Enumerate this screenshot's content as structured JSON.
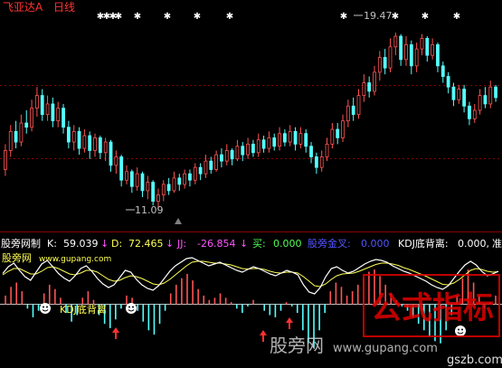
{
  "stock_title": "飞亚达A",
  "period": "日线",
  "colors": {
    "background": "#000000",
    "up": "#ff5454",
    "down": "#54ffff",
    "k_line": "#ffffff",
    "d_line": "#ffff54",
    "grid": "#8b0000",
    "title_red": "#ff3333",
    "magenta": "#ff54ff",
    "green": "#54ff54",
    "blue": "#5454ff",
    "yellow": "#ffff54"
  },
  "indicator": {
    "name": "股旁网制",
    "k_label": "K:",
    "k_value": "59.039",
    "k_arrow": "↓",
    "d_label": "D:",
    "d_value": "72.465",
    "d_arrow": "↓",
    "jj_label": "JJ:",
    "jj_value": "-26.854",
    "jj_arrow": "↓",
    "buy_label": "买:",
    "buy_value": "0.000",
    "gold_label": "股旁金叉:",
    "gold_value": "0.000",
    "kdj_label": "KDJ底背离:",
    "kdj_value": "0.000,",
    "trail": "准"
  },
  "site_name": "股旁网",
  "site_url": "www.gupang.com",
  "kdj_tag": "KDJ底背离",
  "watermark": {
    "cn": "股旁网",
    "url": "www.gupang.com",
    "seal": "公式指标",
    "seal_url": "gszb.com"
  },
  "chart_data": {
    "type": "candlestick",
    "price_high_label": "19.47",
    "price_low_label": "11.09",
    "ylim": [
      10.5,
      20.5
    ],
    "candles": [
      [
        13.0,
        13.9,
        12.7,
        14.2
      ],
      [
        13.9,
        14.8,
        13.6,
        15.1
      ],
      [
        14.8,
        14.3,
        14.0,
        15.3
      ],
      [
        14.3,
        15.2,
        14.1,
        15.6
      ],
      [
        15.2,
        15.0,
        14.7,
        15.8
      ],
      [
        15.0,
        15.9,
        14.8,
        16.3
      ],
      [
        15.9,
        16.5,
        15.5,
        16.9
      ],
      [
        16.5,
        15.6,
        15.3,
        16.8
      ],
      [
        15.6,
        16.1,
        15.3,
        16.5
      ],
      [
        16.1,
        15.3,
        15.0,
        16.4
      ],
      [
        15.3,
        15.9,
        15.0,
        16.2
      ],
      [
        15.9,
        15.0,
        14.7,
        16.1
      ],
      [
        15.0,
        14.3,
        14.0,
        15.3
      ],
      [
        14.3,
        14.8,
        13.9,
        15.1
      ],
      [
        14.8,
        14.0,
        13.7,
        15.0
      ],
      [
        14.0,
        14.6,
        13.8,
        14.9
      ],
      [
        14.6,
        13.9,
        13.5,
        14.8
      ],
      [
        13.9,
        14.5,
        13.6,
        14.7
      ],
      [
        14.5,
        13.8,
        13.5,
        14.6
      ],
      [
        13.8,
        14.3,
        13.4,
        14.5
      ],
      [
        14.3,
        13.2,
        12.9,
        14.4
      ],
      [
        13.2,
        13.6,
        12.8,
        13.9
      ],
      [
        13.6,
        12.5,
        12.2,
        13.7
      ],
      [
        12.5,
        12.9,
        12.3,
        13.2
      ],
      [
        12.9,
        12.2,
        11.9,
        13.0
      ],
      [
        12.2,
        12.8,
        12.0,
        13.1
      ],
      [
        12.8,
        12.0,
        11.7,
        12.9
      ],
      [
        12.0,
        12.4,
        11.6,
        12.7
      ],
      [
        12.4,
        11.5,
        11.3,
        12.5
      ],
      [
        11.5,
        11.8,
        11.09,
        12.1
      ],
      [
        11.8,
        12.3,
        11.5,
        12.5
      ],
      [
        12.3,
        12.0,
        11.8,
        12.6
      ],
      [
        12.0,
        12.6,
        11.9,
        12.9
      ],
      [
        12.6,
        12.3,
        12.0,
        12.8
      ],
      [
        12.3,
        12.8,
        12.1,
        13.0
      ],
      [
        12.8,
        12.5,
        12.2,
        13.0
      ],
      [
        12.5,
        13.1,
        12.3,
        13.3
      ],
      [
        13.1,
        12.8,
        12.5,
        13.3
      ],
      [
        12.8,
        13.4,
        12.6,
        13.7
      ],
      [
        13.4,
        13.0,
        12.8,
        13.6
      ],
      [
        13.0,
        13.7,
        12.9,
        13.9
      ],
      [
        13.7,
        13.4,
        13.1,
        14.0
      ],
      [
        13.4,
        13.9,
        13.2,
        14.2
      ],
      [
        13.9,
        13.5,
        13.2,
        14.0
      ],
      [
        13.5,
        14.1,
        13.4,
        14.4
      ],
      [
        14.1,
        13.7,
        13.4,
        14.3
      ],
      [
        13.7,
        14.2,
        13.5,
        14.5
      ],
      [
        14.2,
        13.8,
        13.6,
        14.4
      ],
      [
        13.8,
        14.4,
        13.6,
        14.7
      ],
      [
        14.4,
        14.0,
        13.8,
        14.6
      ],
      [
        14.0,
        14.5,
        13.8,
        14.8
      ],
      [
        14.5,
        14.1,
        13.9,
        14.7
      ],
      [
        14.1,
        14.7,
        13.9,
        15.0
      ],
      [
        14.7,
        14.3,
        14.1,
        14.9
      ],
      [
        14.3,
        14.8,
        14.1,
        15.1
      ],
      [
        14.8,
        14.2,
        13.9,
        15.0
      ],
      [
        14.2,
        14.7,
        14.0,
        15.0
      ],
      [
        14.7,
        14.1,
        13.8,
        14.9
      ],
      [
        14.1,
        13.6,
        13.3,
        14.3
      ],
      [
        13.6,
        13.1,
        12.8,
        13.8
      ],
      [
        13.1,
        13.6,
        12.9,
        13.9
      ],
      [
        13.6,
        14.2,
        13.4,
        14.5
      ],
      [
        14.2,
        14.9,
        14.0,
        15.2
      ],
      [
        14.9,
        14.5,
        14.2,
        15.2
      ],
      [
        14.5,
        15.3,
        14.3,
        15.6
      ],
      [
        15.3,
        16.0,
        15.0,
        16.3
      ],
      [
        16.0,
        15.6,
        15.3,
        16.4
      ],
      [
        15.6,
        16.5,
        15.4,
        16.8
      ],
      [
        16.5,
        17.1,
        16.2,
        17.5
      ],
      [
        17.1,
        16.7,
        16.4,
        17.4
      ],
      [
        16.7,
        17.6,
        16.5,
        17.9
      ],
      [
        17.6,
        18.3,
        17.2,
        18.6
      ],
      [
        18.3,
        17.8,
        17.5,
        18.7
      ],
      [
        17.8,
        18.8,
        17.6,
        19.2
      ],
      [
        18.8,
        19.3,
        18.4,
        19.47
      ],
      [
        19.3,
        18.2,
        17.9,
        19.4
      ],
      [
        18.2,
        18.9,
        17.9,
        19.3
      ],
      [
        18.9,
        17.9,
        17.5,
        19.1
      ],
      [
        17.9,
        18.7,
        17.6,
        19.0
      ],
      [
        18.7,
        19.2,
        18.4,
        19.4
      ],
      [
        19.2,
        18.4,
        18.1,
        19.3
      ],
      [
        18.4,
        18.9,
        18.2,
        19.2
      ],
      [
        18.9,
        17.9,
        17.6,
        19.0
      ],
      [
        17.9,
        17.4,
        17.1,
        18.1
      ],
      [
        17.4,
        16.9,
        16.6,
        17.6
      ],
      [
        16.9,
        16.3,
        16.0,
        17.1
      ],
      [
        16.3,
        16.8,
        16.1,
        17.0
      ],
      [
        16.8,
        16.0,
        15.7,
        17.0
      ],
      [
        16.0,
        15.4,
        15.1,
        16.2
      ],
      [
        15.4,
        15.8,
        15.2,
        16.1
      ],
      [
        15.8,
        16.5,
        15.6,
        16.8
      ],
      [
        16.5,
        16.1,
        15.9,
        16.9
      ],
      [
        16.1,
        16.9,
        15.9,
        17.2
      ],
      [
        16.9,
        16.4,
        16.2,
        17.0
      ]
    ],
    "k_series": [
      55,
      70,
      78,
      62,
      48,
      40,
      58,
      76,
      84,
      70,
      55,
      45,
      38,
      50,
      66,
      72,
      60,
      44,
      32,
      24,
      30,
      46,
      62,
      58,
      42,
      30,
      22,
      18,
      28,
      44,
      60,
      72,
      80,
      88,
      90,
      84,
      78,
      72,
      76,
      80,
      74,
      68,
      62,
      58,
      64,
      70,
      66,
      60,
      54,
      50,
      56,
      62,
      58,
      52,
      30,
      14,
      10,
      24,
      48,
      66,
      70,
      62,
      56,
      60,
      68,
      76,
      82,
      86,
      84,
      80,
      72,
      66,
      60,
      56,
      50,
      44,
      38,
      30,
      24,
      20,
      28,
      44,
      60,
      74,
      82,
      74,
      60,
      50,
      54,
      60
    ],
    "d_series": [
      52,
      60,
      66,
      66,
      60,
      54,
      54,
      60,
      68,
      70,
      66,
      60,
      54,
      52,
      56,
      62,
      62,
      58,
      50,
      42,
      38,
      40,
      46,
      50,
      48,
      44,
      38,
      32,
      30,
      34,
      42,
      52,
      62,
      72,
      80,
      82,
      82,
      80,
      78,
      78,
      76,
      74,
      70,
      66,
      65,
      66,
      66,
      64,
      60,
      57,
      56,
      58,
      58,
      56,
      48,
      38,
      28,
      26,
      32,
      42,
      50,
      54,
      55,
      56,
      60,
      65,
      70,
      75,
      78,
      78,
      76,
      73,
      68,
      64,
      59,
      54,
      49,
      43,
      37,
      31,
      30,
      34,
      42,
      52,
      62,
      66,
      64,
      60,
      58,
      59
    ],
    "macd_hist": [
      4,
      8,
      10,
      6,
      -2,
      -6,
      -3,
      5,
      9,
      7,
      3,
      -4,
      -8,
      -5,
      3,
      6,
      2,
      -5,
      -9,
      -11,
      -7,
      -2,
      4,
      3,
      -3,
      -8,
      -12,
      -14,
      -9,
      -3,
      5,
      9,
      12,
      14,
      11,
      7,
      4,
      2,
      3,
      5,
      3,
      1,
      -2,
      -4,
      -1,
      2,
      0,
      -3,
      -5,
      -6,
      -3,
      1,
      -1,
      -4,
      -12,
      -18,
      -20,
      -12,
      -4,
      6,
      10,
      8,
      4,
      6,
      9,
      12,
      15,
      16,
      13,
      9,
      5,
      2,
      -1,
      -3,
      -6,
      -9,
      -12,
      -15,
      -17,
      -18,
      -12,
      -5,
      4,
      12,
      16,
      10,
      4,
      -2,
      1,
      4
    ]
  }
}
